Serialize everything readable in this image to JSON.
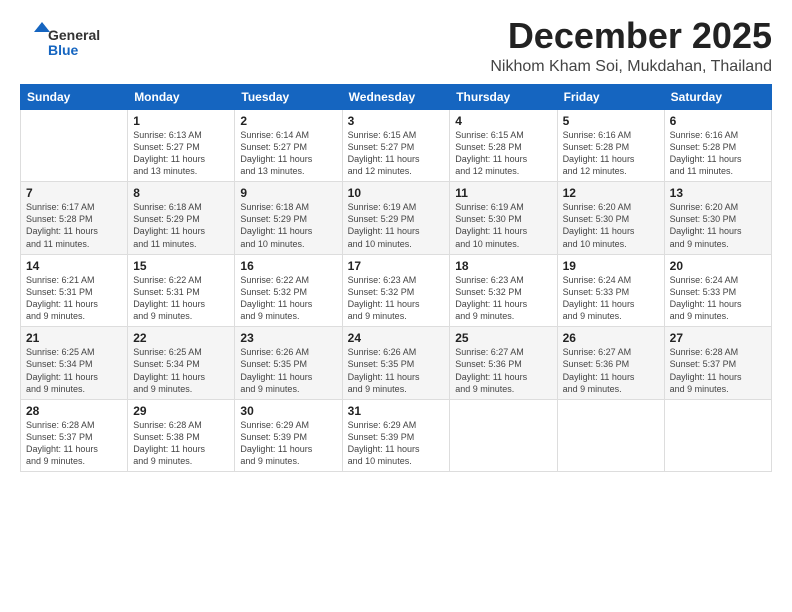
{
  "header": {
    "logo": {
      "line1": "General",
      "line2": "Blue"
    },
    "title": "December 2025",
    "location": "Nikhom Kham Soi, Mukdahan, Thailand"
  },
  "calendar": {
    "days_of_week": [
      "Sunday",
      "Monday",
      "Tuesday",
      "Wednesday",
      "Thursday",
      "Friday",
      "Saturday"
    ],
    "weeks": [
      [
        {
          "day": "",
          "info": ""
        },
        {
          "day": "1",
          "info": "Sunrise: 6:13 AM\nSunset: 5:27 PM\nDaylight: 11 hours\nand 13 minutes."
        },
        {
          "day": "2",
          "info": "Sunrise: 6:14 AM\nSunset: 5:27 PM\nDaylight: 11 hours\nand 13 minutes."
        },
        {
          "day": "3",
          "info": "Sunrise: 6:15 AM\nSunset: 5:27 PM\nDaylight: 11 hours\nand 12 minutes."
        },
        {
          "day": "4",
          "info": "Sunrise: 6:15 AM\nSunset: 5:28 PM\nDaylight: 11 hours\nand 12 minutes."
        },
        {
          "day": "5",
          "info": "Sunrise: 6:16 AM\nSunset: 5:28 PM\nDaylight: 11 hours\nand 12 minutes."
        },
        {
          "day": "6",
          "info": "Sunrise: 6:16 AM\nSunset: 5:28 PM\nDaylight: 11 hours\nand 11 minutes."
        }
      ],
      [
        {
          "day": "7",
          "info": "Sunrise: 6:17 AM\nSunset: 5:28 PM\nDaylight: 11 hours\nand 11 minutes."
        },
        {
          "day": "8",
          "info": "Sunrise: 6:18 AM\nSunset: 5:29 PM\nDaylight: 11 hours\nand 11 minutes."
        },
        {
          "day": "9",
          "info": "Sunrise: 6:18 AM\nSunset: 5:29 PM\nDaylight: 11 hours\nand 10 minutes."
        },
        {
          "day": "10",
          "info": "Sunrise: 6:19 AM\nSunset: 5:29 PM\nDaylight: 11 hours\nand 10 minutes."
        },
        {
          "day": "11",
          "info": "Sunrise: 6:19 AM\nSunset: 5:30 PM\nDaylight: 11 hours\nand 10 minutes."
        },
        {
          "day": "12",
          "info": "Sunrise: 6:20 AM\nSunset: 5:30 PM\nDaylight: 11 hours\nand 10 minutes."
        },
        {
          "day": "13",
          "info": "Sunrise: 6:20 AM\nSunset: 5:30 PM\nDaylight: 11 hours\nand 9 minutes."
        }
      ],
      [
        {
          "day": "14",
          "info": "Sunrise: 6:21 AM\nSunset: 5:31 PM\nDaylight: 11 hours\nand 9 minutes."
        },
        {
          "day": "15",
          "info": "Sunrise: 6:22 AM\nSunset: 5:31 PM\nDaylight: 11 hours\nand 9 minutes."
        },
        {
          "day": "16",
          "info": "Sunrise: 6:22 AM\nSunset: 5:32 PM\nDaylight: 11 hours\nand 9 minutes."
        },
        {
          "day": "17",
          "info": "Sunrise: 6:23 AM\nSunset: 5:32 PM\nDaylight: 11 hours\nand 9 minutes."
        },
        {
          "day": "18",
          "info": "Sunrise: 6:23 AM\nSunset: 5:32 PM\nDaylight: 11 hours\nand 9 minutes."
        },
        {
          "day": "19",
          "info": "Sunrise: 6:24 AM\nSunset: 5:33 PM\nDaylight: 11 hours\nand 9 minutes."
        },
        {
          "day": "20",
          "info": "Sunrise: 6:24 AM\nSunset: 5:33 PM\nDaylight: 11 hours\nand 9 minutes."
        }
      ],
      [
        {
          "day": "21",
          "info": "Sunrise: 6:25 AM\nSunset: 5:34 PM\nDaylight: 11 hours\nand 9 minutes."
        },
        {
          "day": "22",
          "info": "Sunrise: 6:25 AM\nSunset: 5:34 PM\nDaylight: 11 hours\nand 9 minutes."
        },
        {
          "day": "23",
          "info": "Sunrise: 6:26 AM\nSunset: 5:35 PM\nDaylight: 11 hours\nand 9 minutes."
        },
        {
          "day": "24",
          "info": "Sunrise: 6:26 AM\nSunset: 5:35 PM\nDaylight: 11 hours\nand 9 minutes."
        },
        {
          "day": "25",
          "info": "Sunrise: 6:27 AM\nSunset: 5:36 PM\nDaylight: 11 hours\nand 9 minutes."
        },
        {
          "day": "26",
          "info": "Sunrise: 6:27 AM\nSunset: 5:36 PM\nDaylight: 11 hours\nand 9 minutes."
        },
        {
          "day": "27",
          "info": "Sunrise: 6:28 AM\nSunset: 5:37 PM\nDaylight: 11 hours\nand 9 minutes."
        }
      ],
      [
        {
          "day": "28",
          "info": "Sunrise: 6:28 AM\nSunset: 5:37 PM\nDaylight: 11 hours\nand 9 minutes."
        },
        {
          "day": "29",
          "info": "Sunrise: 6:28 AM\nSunset: 5:38 PM\nDaylight: 11 hours\nand 9 minutes."
        },
        {
          "day": "30",
          "info": "Sunrise: 6:29 AM\nSunset: 5:39 PM\nDaylight: 11 hours\nand 9 minutes."
        },
        {
          "day": "31",
          "info": "Sunrise: 6:29 AM\nSunset: 5:39 PM\nDaylight: 11 hours\nand 10 minutes."
        },
        {
          "day": "",
          "info": ""
        },
        {
          "day": "",
          "info": ""
        },
        {
          "day": "",
          "info": ""
        }
      ]
    ]
  }
}
